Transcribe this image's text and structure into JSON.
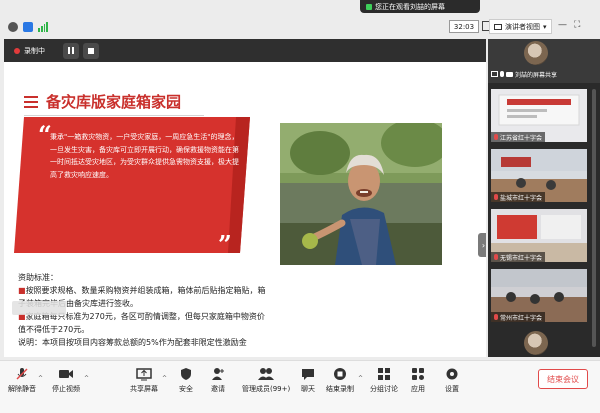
{
  "notify": {
    "text": "您正在观看刘喆的屏幕"
  },
  "topbar": {
    "timer": "32:03",
    "view_mode": "演讲者视图"
  },
  "recording": {
    "status": "录制中"
  },
  "slide": {
    "title": "备灾库版家庭箱家园",
    "quote": "秉承\"一箱救灾物资，一户受灾家庭，一周应急生活\"的理念，一旦发生灾害，备灾库可立即开展行动，确保救援物资能在第一时间抵达受灾地区，为受灾群众提供急需物资支援，极大提高了救灾响应速度。",
    "body_heading": "资助标准：",
    "bullets": [
      "按照要求规格、数量采购物资并组装成箱，箱体前后贴指定箱贴，箱子装箱完毕后由备灾库进行签收。",
      "家庭箱每只标准为270元，各区可酌情调整，但每只家庭箱中物资价值不得低于270元。"
    ],
    "note": "说明：本项目按项目内容筹款总额的5%作为配套非限定性激励金"
  },
  "side_panel": {
    "self_label": "刘喆的屏幕共享",
    "participants": [
      {
        "name": "江苏省红十字会"
      },
      {
        "name": "盐城市红十字会"
      },
      {
        "name": "无锡市红十字会"
      },
      {
        "name": "常州市红十字会"
      }
    ]
  },
  "toolbar": {
    "unmute": "解除静音",
    "stop_video": "停止视频",
    "share_screen": "共享屏幕",
    "security": "安全",
    "invite": "邀请",
    "manage_members": "管理成员(99+)",
    "chat": "聊天",
    "end_recording": "结束录制",
    "breakout": "分组讨论",
    "apps": "应用",
    "settings": "设置",
    "end_meeting": "结束会议"
  },
  "colors": {
    "brand_red": "#c9302c",
    "end_red": "#e14a4a",
    "wifi_green": "#2fb548"
  }
}
